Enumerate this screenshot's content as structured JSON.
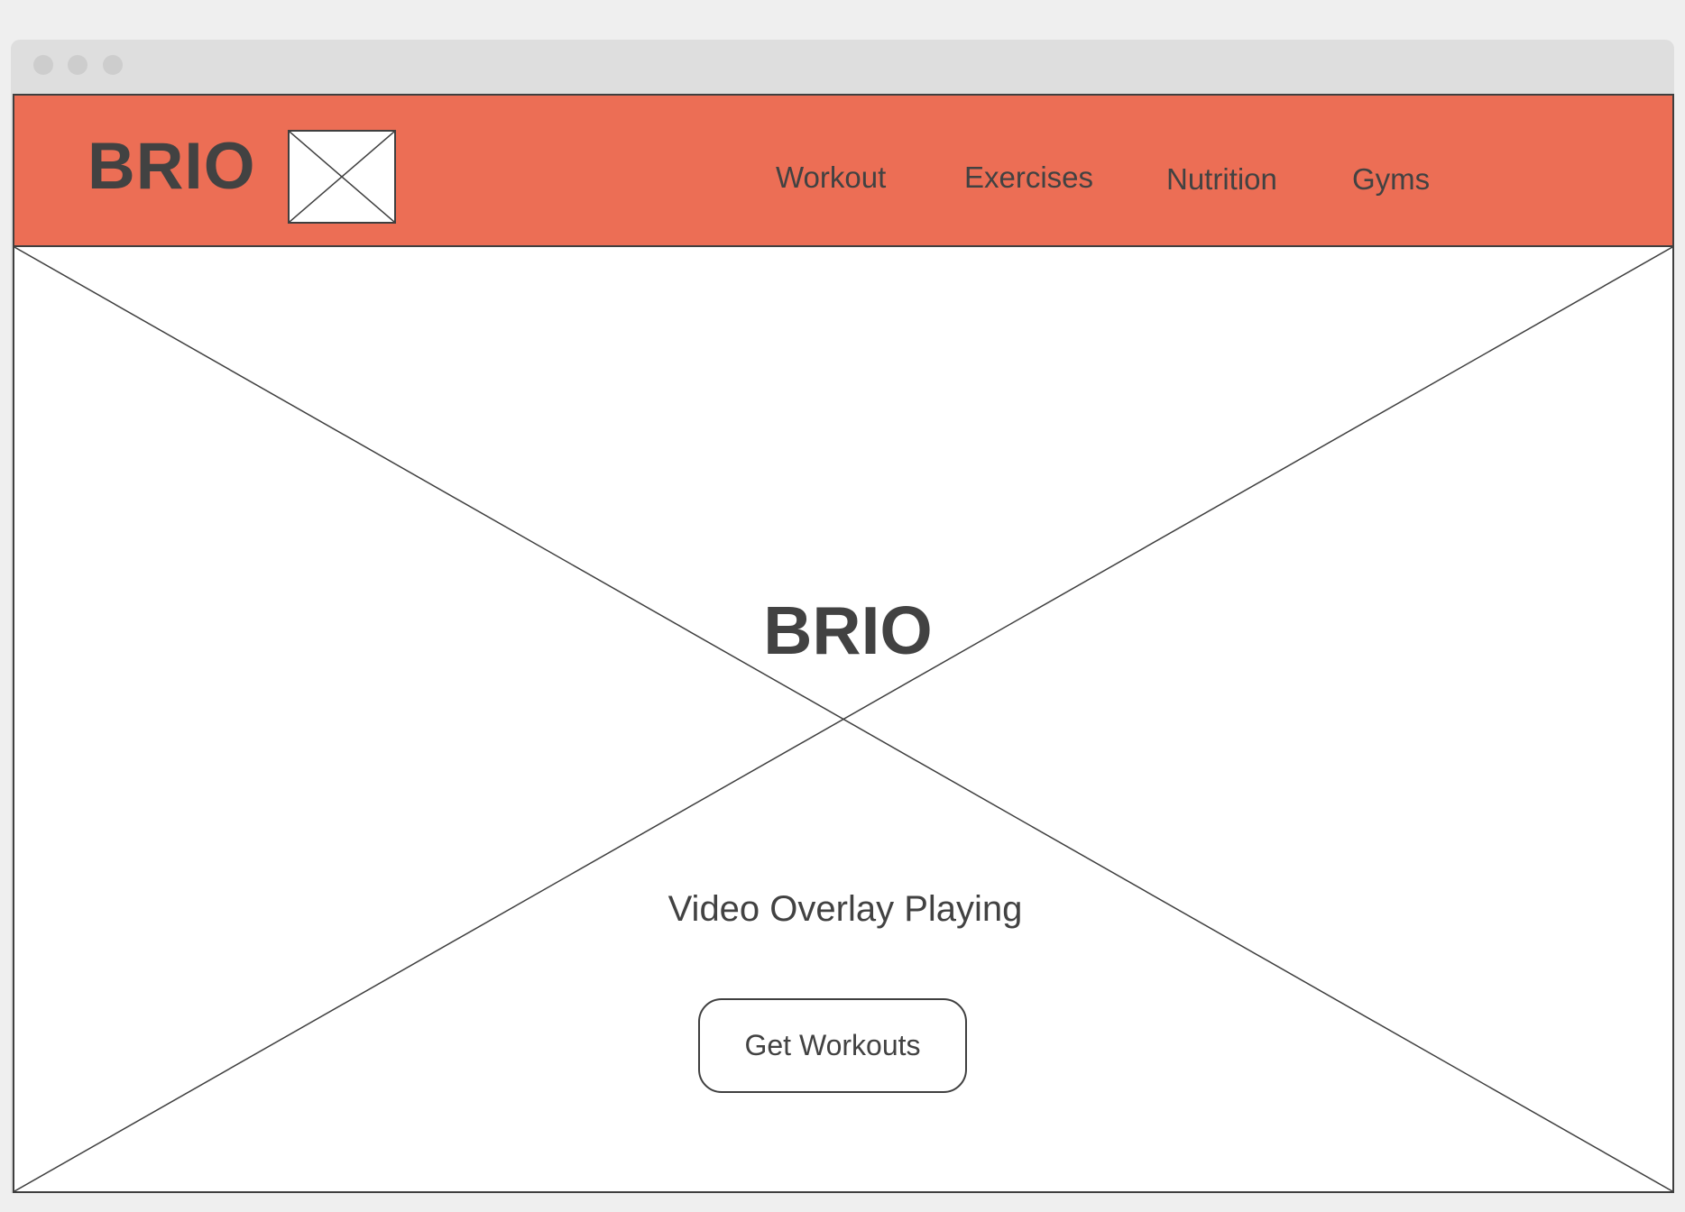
{
  "header": {
    "brand": "BRIO",
    "logo_icon": "image-placeholder-icon",
    "background_color": "#ec6e55",
    "nav": [
      {
        "label": "Workout"
      },
      {
        "label": "Exercises"
      },
      {
        "label": "Nutrition"
      },
      {
        "label": "Gyms"
      }
    ]
  },
  "hero": {
    "media_icon": "video-placeholder-icon",
    "title": "BRIO",
    "subtitle": "Video Overlay Playing",
    "cta_label": "Get Workouts"
  },
  "colors": {
    "text": "#424242",
    "stroke": "#3f3f3f",
    "page_background": "#efefef",
    "window_chrome": "#dedede"
  }
}
